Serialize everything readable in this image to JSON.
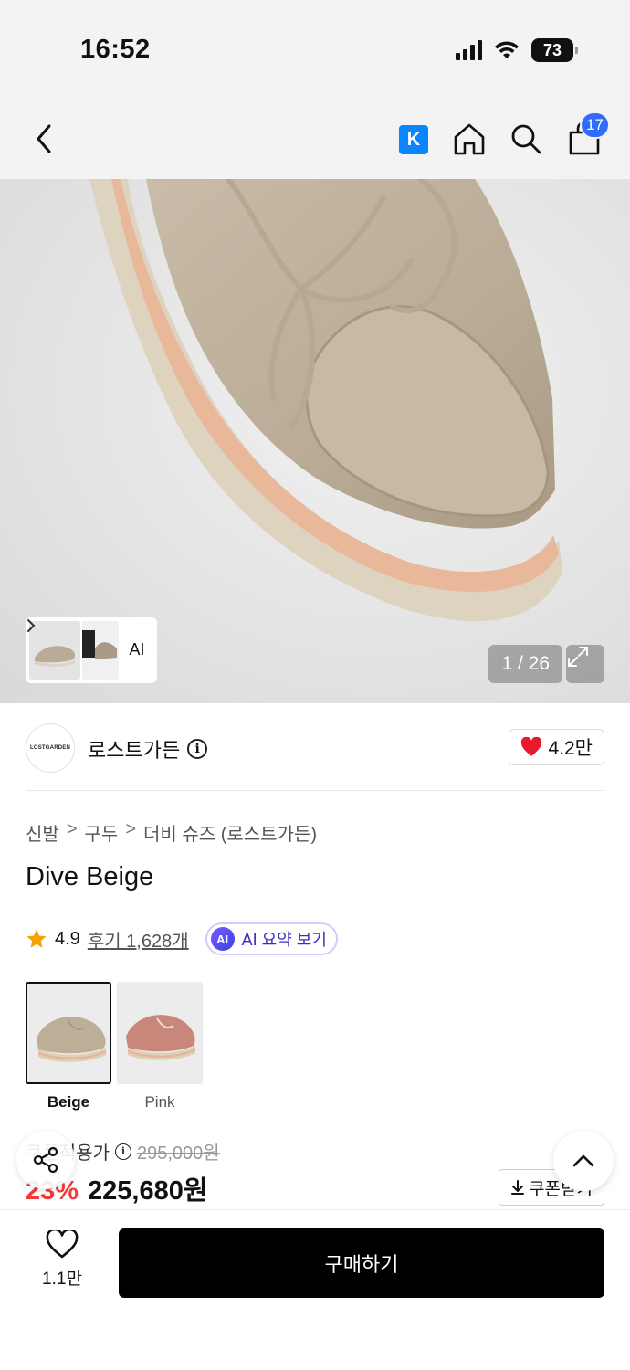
{
  "status_bar": {
    "time": "16:52",
    "battery": "73",
    "icons": [
      "signal-icon",
      "wifi-icon",
      "battery-icon"
    ]
  },
  "nav": {
    "icons": [
      "back-arrow-icon",
      "k-icon",
      "home-icon",
      "search-icon",
      "shopping-bag-icon"
    ],
    "k_label": "K",
    "cart_count": "17"
  },
  "gallery": {
    "thumb_ai_label": "AI",
    "page_counter": "1 / 26",
    "current_page": 1,
    "total_pages": 26
  },
  "brand": {
    "logo_text": "LOSTGARDEN",
    "name": "로스트가든",
    "likes": "4.2만",
    "accent_color": "#e8192c"
  },
  "breadcrumb": [
    "신발",
    "구두",
    "더비 슈즈 (로스트가든)"
  ],
  "product": {
    "title": "Dive Beige",
    "rating": "4.9",
    "reviews": "후기 1,628개",
    "ai_badge": "AI",
    "ai_summary": "AI 요약 보기"
  },
  "colors": [
    {
      "label": "Beige",
      "selected": true
    },
    {
      "label": "Pink",
      "selected": false
    }
  ],
  "price": {
    "original_label": "쿠폰적용가",
    "original_price": "295,000원",
    "discount": "23%",
    "sale_price": "225,680원",
    "coupon_button": "쿠폰받기",
    "discount_color": "#f23a3a"
  },
  "bottom": {
    "wish_count": "1.1만",
    "buy_button": "구매하기"
  }
}
